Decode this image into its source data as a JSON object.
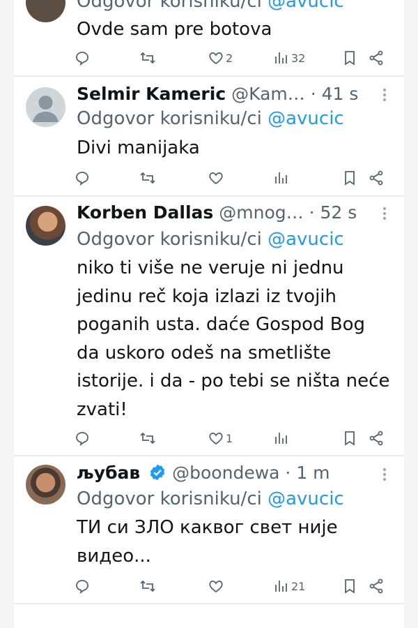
{
  "tweets": [
    {
      "name": "",
      "handle": "",
      "time": "",
      "reply_prefix": "Odgovor korisniku/ci",
      "reply_to": "@avucic",
      "text": "Ovde sam pre botova",
      "likes": "2",
      "views": "32",
      "avatar": "user-photo-avatar"
    },
    {
      "name": "Selmir Kameric",
      "handle": "@Kam…",
      "time": "41 s",
      "reply_prefix": "Odgovor korisniku/ci",
      "reply_to": "@avucic",
      "text": "Divi manijaka",
      "likes": "",
      "views": "",
      "avatar": "default-person-avatar"
    },
    {
      "name": "Korben Dallas",
      "handle": "@mnog…",
      "time": "52 s",
      "reply_prefix": "Odgovor korisniku/ci",
      "reply_to": "@avucic",
      "text": "niko ti više ne veruje ni jednu jedinu reč koja izlazi iz tvojih poganih usta. daće Gospod Bog da uskoro odeš na smetlište istorije. i da - po tebi se ništa neće zvati!",
      "likes": "1",
      "views": "",
      "avatar": "user-photo-avatar"
    },
    {
      "name": "љубав",
      "handle": "@boondewa",
      "time": "1 m",
      "reply_prefix": "Odgovor korisniku/ci",
      "reply_to": "@avucic",
      "text": "ТИ си ЗЛО каквог свет није видео...",
      "likes": "",
      "views": "21",
      "avatar": "user-photo-avatar",
      "verified": "verified-badge-icon"
    }
  ],
  "colors": {
    "text": "#0f1419",
    "secondary": "#536471",
    "link": "#1d9bf0",
    "divider": "#e9ecef"
  }
}
